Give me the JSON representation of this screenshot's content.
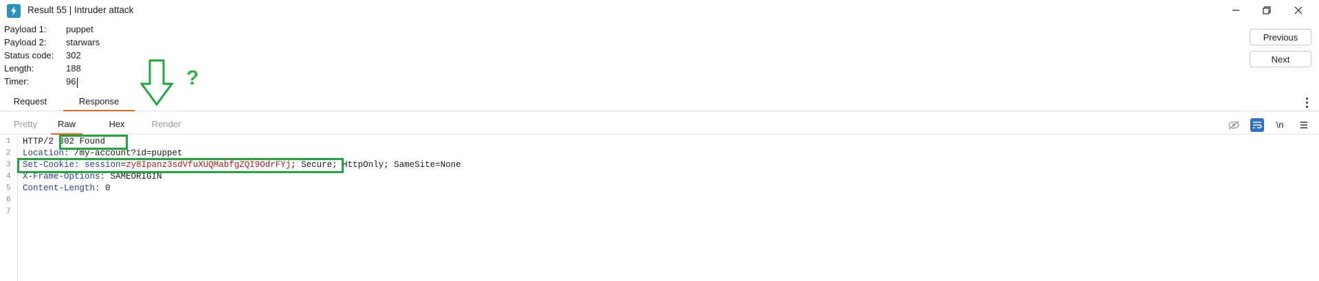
{
  "window": {
    "title": "Result 55 | Intruder attack",
    "controls": [
      "minimize-icon",
      "restore-icon",
      "close-icon"
    ]
  },
  "attack": {
    "rows": [
      {
        "label": "Payload 1:",
        "value": "puppet"
      },
      {
        "label": "Payload 2:",
        "value": "starwars"
      },
      {
        "label": "Status code:",
        "value": "302"
      },
      {
        "label": "Length:",
        "value": "188"
      },
      {
        "label": "Timer:",
        "value": "96"
      }
    ]
  },
  "nav": {
    "previous": "Previous",
    "next": "Next"
  },
  "annotation": {
    "question": "?"
  },
  "main_tabs": [
    {
      "label": "Request",
      "active": false
    },
    {
      "label": "Response",
      "active": true
    }
  ],
  "sub_tabs": [
    {
      "label": "Pretty",
      "state": "dim"
    },
    {
      "label": "Raw",
      "state": "active"
    },
    {
      "label": "Hex",
      "state": "normal"
    },
    {
      "label": "Render",
      "state": "dim"
    }
  ],
  "toolbar": {
    "icons": [
      "hide-nonprintable-icon",
      "wrap-lines-icon",
      "newline-toggle-icon",
      "menu-icon"
    ],
    "newline_label": "\\n"
  },
  "response": {
    "line_numbers": [
      "1",
      "2",
      "3",
      "4",
      "5",
      "6",
      "7"
    ],
    "line1": {
      "protocol": "HTTP/2",
      "status": "302 Found"
    },
    "line2": {
      "key": "Location:",
      "value": "/my-account?id=puppet"
    },
    "line3": {
      "key": "Set-Cookie:",
      "cookie_name": "session",
      "cookie_value": "zy8Ipanz3sdVfuXUQMabfgZQI9OdrFYj",
      "rest": "; Secure; HttpOnly; SameSite=None"
    },
    "line4": {
      "key": "X-Frame-Options:",
      "value": "SAMEORIGIN"
    },
    "line5": {
      "key": "Content-Length:",
      "value": "0"
    }
  },
  "colors": {
    "accent_tab": "#e8651f",
    "annotation_green": "#1ea83c",
    "header_key": "#263d94",
    "cookie_value": "#c4141b",
    "app_icon": "#2a8fbd"
  }
}
